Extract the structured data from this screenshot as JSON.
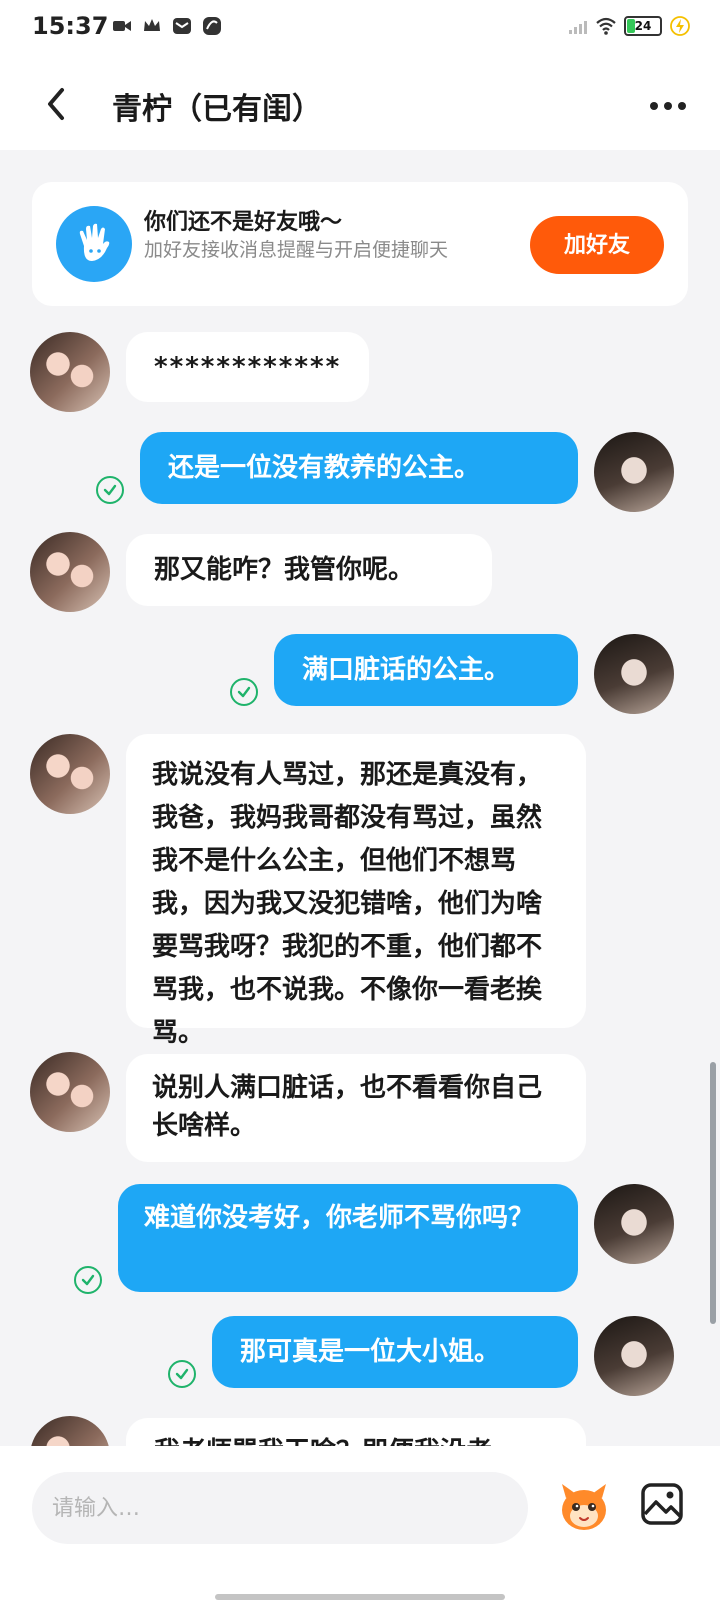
{
  "status_bar": {
    "time": "15:37",
    "battery_level": "24",
    "left_icons": [
      "video-icon",
      "crown-icon",
      "mail-icon",
      "app-icon"
    ],
    "right_icons": [
      "signal-icon",
      "wifi-icon",
      "battery-icon",
      "charging-icon"
    ]
  },
  "header": {
    "title": "青柠（已有闺）",
    "back_icon": "chevron-left-icon",
    "more_icon": "more-horizontal-icon"
  },
  "friend_prompt": {
    "title": "你们还不是好友哦～",
    "description": "加好友接收消息提醒与开启便捷聊天",
    "button_label": "加好友",
    "icon": "waving-hand-icon",
    "button_color": "#ff5a0a"
  },
  "messages": [
    {
      "side": "in",
      "text": "************"
    },
    {
      "side": "out",
      "text": "还是一位没有教养的公主。",
      "read": true
    },
    {
      "side": "in",
      "text": "那又能咋？我管你呢。"
    },
    {
      "side": "out",
      "text": "满口脏话的公主。",
      "read": true
    },
    {
      "side": "in",
      "text": "我说没有人骂过，那还是真没有，我爸，我妈我哥都没有骂过，虽然我不是什么公主，但他们不想骂我，因为我又没犯错啥，他们为啥要骂我呀？我犯的不重，他们都不骂我，也不说我。不像你一看老挨骂。"
    },
    {
      "side": "in",
      "text": "说别人满口脏话，也不看看你自己长啥样。"
    },
    {
      "side": "out",
      "text": "难道你没考好，你老师不骂你吗？",
      "read": true
    },
    {
      "side": "out",
      "text": "那可真是一位大小姐。",
      "read": true
    },
    {
      "side": "in",
      "text": "我老师骂我干啥？即便我没考"
    }
  ],
  "input_bar": {
    "placeholder": "请输入…",
    "emoji_icon": "mascot-emoji-icon",
    "image_icon": "image-icon"
  },
  "colors": {
    "outgoing_bubble": "#1ea7f5",
    "incoming_bubble": "#ffffff",
    "read_check": "#1fb36b",
    "background": "#f4f4f6"
  }
}
